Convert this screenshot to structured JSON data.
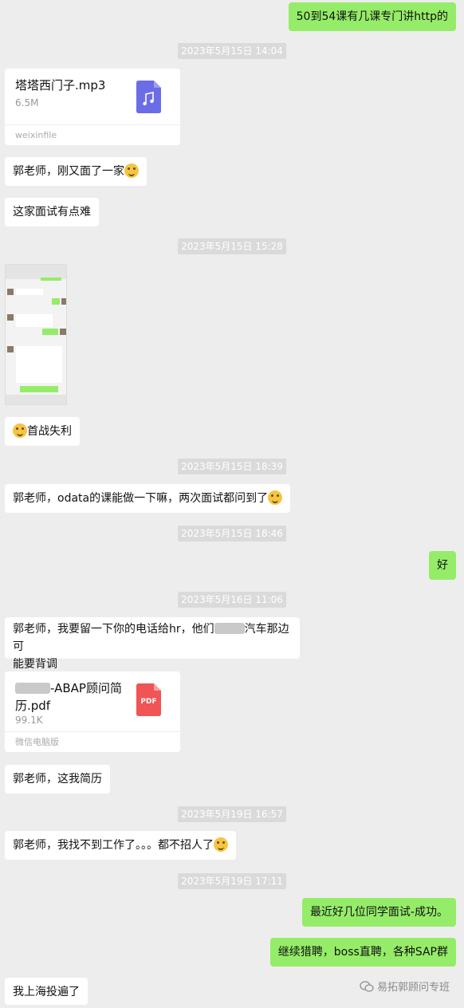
{
  "messages": {
    "m1": "50到54课有几课专门讲http的",
    "ts1": "2023年5月15日 14:04",
    "file1": {
      "name": "塔塔西门子.mp3",
      "size": "6.5M",
      "source": "weixinfile",
      "icon": "music-file-icon",
      "color": "#6c6ce6"
    },
    "m2": "郭老师，刚又面了一家",
    "m3": "这家面试有点难",
    "ts2": "2023年5月15日 15:28",
    "m4": "首战失利",
    "ts3": "2023年5月15日 18:39",
    "m5": "郭老师，odata的课能做一下嘛，两次面试都问到了",
    "ts4": "2023年5月15日 18:46",
    "m6": "好",
    "ts5": "2023年5月16日 11:06",
    "m7a": "郭老师，我要留一下你的电话给hr，他们",
    "m7b": "汽车那边可",
    "m7c": "能要背调",
    "file2": {
      "name_suffix": "-ABAP顾问简",
      "name_line2": "历.pdf",
      "size": "99.1K",
      "source": "微信电脑版",
      "badge": "PDF",
      "color": "#f05454"
    },
    "m8": "郭老师，这我简历",
    "ts6": "2023年5月19日 16:57",
    "m9": "郭老师，我找不到工作了。。。都不招人了",
    "ts7": "2023年5月19日 17:11",
    "m10": "最近好几位同学面试-成功。",
    "m11": "继续猎聘，boss直聘，各种SAP群",
    "m12": "我上海投遍了",
    "watermark": "易拓郭顾问专班"
  },
  "colors": {
    "self_bubble": "#95ec69",
    "other_bubble": "#ffffff",
    "background": "#ededed"
  }
}
